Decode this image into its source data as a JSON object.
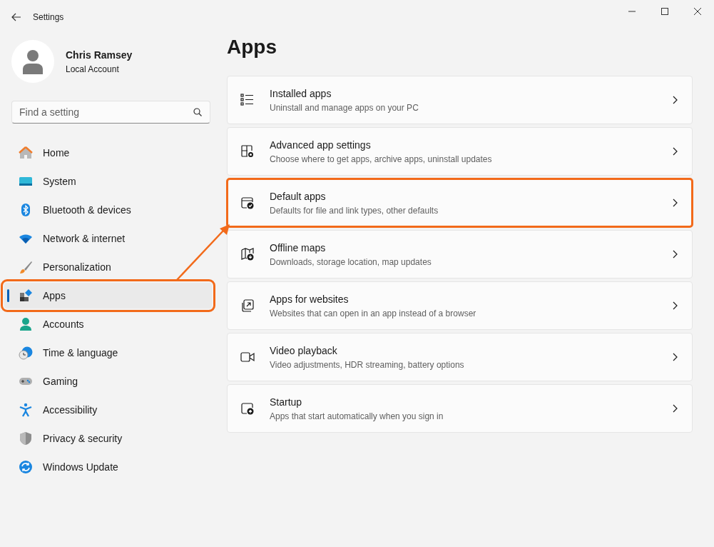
{
  "window": {
    "title": "Settings"
  },
  "profile": {
    "name": "Chris Ramsey",
    "account_type": "Local Account"
  },
  "search": {
    "placeholder": "Find a setting"
  },
  "sidebar": {
    "items": [
      {
        "label": "Home",
        "selected": false,
        "highlighted": false
      },
      {
        "label": "System",
        "selected": false,
        "highlighted": false
      },
      {
        "label": "Bluetooth & devices",
        "selected": false,
        "highlighted": false
      },
      {
        "label": "Network & internet",
        "selected": false,
        "highlighted": false
      },
      {
        "label": "Personalization",
        "selected": false,
        "highlighted": false
      },
      {
        "label": "Apps",
        "selected": true,
        "highlighted": true
      },
      {
        "label": "Accounts",
        "selected": false,
        "highlighted": false
      },
      {
        "label": "Time & language",
        "selected": false,
        "highlighted": false
      },
      {
        "label": "Gaming",
        "selected": false,
        "highlighted": false
      },
      {
        "label": "Accessibility",
        "selected": false,
        "highlighted": false
      },
      {
        "label": "Privacy & security",
        "selected": false,
        "highlighted": false
      },
      {
        "label": "Windows Update",
        "selected": false,
        "highlighted": false
      }
    ]
  },
  "page": {
    "title": "Apps",
    "cards": [
      {
        "title": "Installed apps",
        "description": "Uninstall and manage apps on your PC",
        "highlighted": false
      },
      {
        "title": "Advanced app settings",
        "description": "Choose where to get apps, archive apps, uninstall updates",
        "highlighted": false
      },
      {
        "title": "Default apps",
        "description": "Defaults for file and link types, other defaults",
        "highlighted": true
      },
      {
        "title": "Offline maps",
        "description": "Downloads, storage location, map updates",
        "highlighted": false
      },
      {
        "title": "Apps for websites",
        "description": "Websites that can open in an app instead of a browser",
        "highlighted": false
      },
      {
        "title": "Video playback",
        "description": "Video adjustments, HDR streaming, battery options",
        "highlighted": false
      },
      {
        "title": "Startup",
        "description": "Apps that start automatically when you sign in",
        "highlighted": false
      }
    ]
  }
}
